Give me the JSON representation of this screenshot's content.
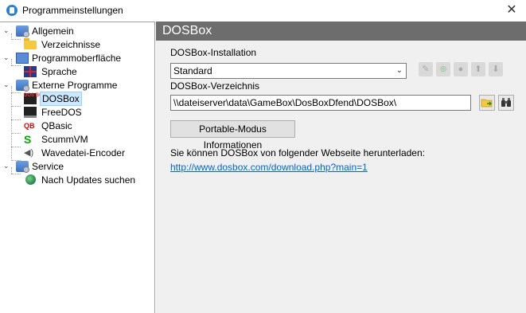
{
  "window": {
    "title": "Programmeinstellungen",
    "close_glyph": "✕"
  },
  "tree": {
    "items": [
      {
        "label": "Allgemein",
        "icon": "settings-icon"
      },
      {
        "label": "Verzeichnisse",
        "icon": "folder-icon"
      },
      {
        "label": "Programmoberfläche",
        "icon": "window-icon"
      },
      {
        "label": "Sprache",
        "icon": "uk-flag-icon"
      },
      {
        "label": "Externe Programme",
        "icon": "settings-icon"
      },
      {
        "label": "DOSBox",
        "icon": "dosbox-icon",
        "selected": true
      },
      {
        "label": "FreeDOS",
        "icon": "freedos-icon"
      },
      {
        "label": "QBasic",
        "icon": "qbasic-icon"
      },
      {
        "label": "ScummVM",
        "icon": "scummvm-icon"
      },
      {
        "label": "Wavedatei-Encoder",
        "icon": "speaker-icon"
      },
      {
        "label": "Service",
        "icon": "settings-icon"
      },
      {
        "label": "Nach Updates suchen",
        "icon": "globe-icon"
      }
    ],
    "qb_glyph": "QB",
    "scumm_glyph": "S",
    "wave_glyph": "◀)",
    "dos_glyph": "DOS BOX"
  },
  "panel": {
    "header": "DOSBox",
    "install_label": "DOSBox-Installation",
    "install_selected": "Standard",
    "dir_label": "DOSBox-Verzeichnis",
    "dir_value": "\\\\dateiserver\\data\\GameBox\\DosBoxDfend\\DOSBox\\",
    "portable_button": "Portable-Modus Informationen",
    "download_text": "Sie können DOSBox von folgender Webseite herunterladen:",
    "download_link": "http://www.dosbox.com/download.php?main=1"
  }
}
